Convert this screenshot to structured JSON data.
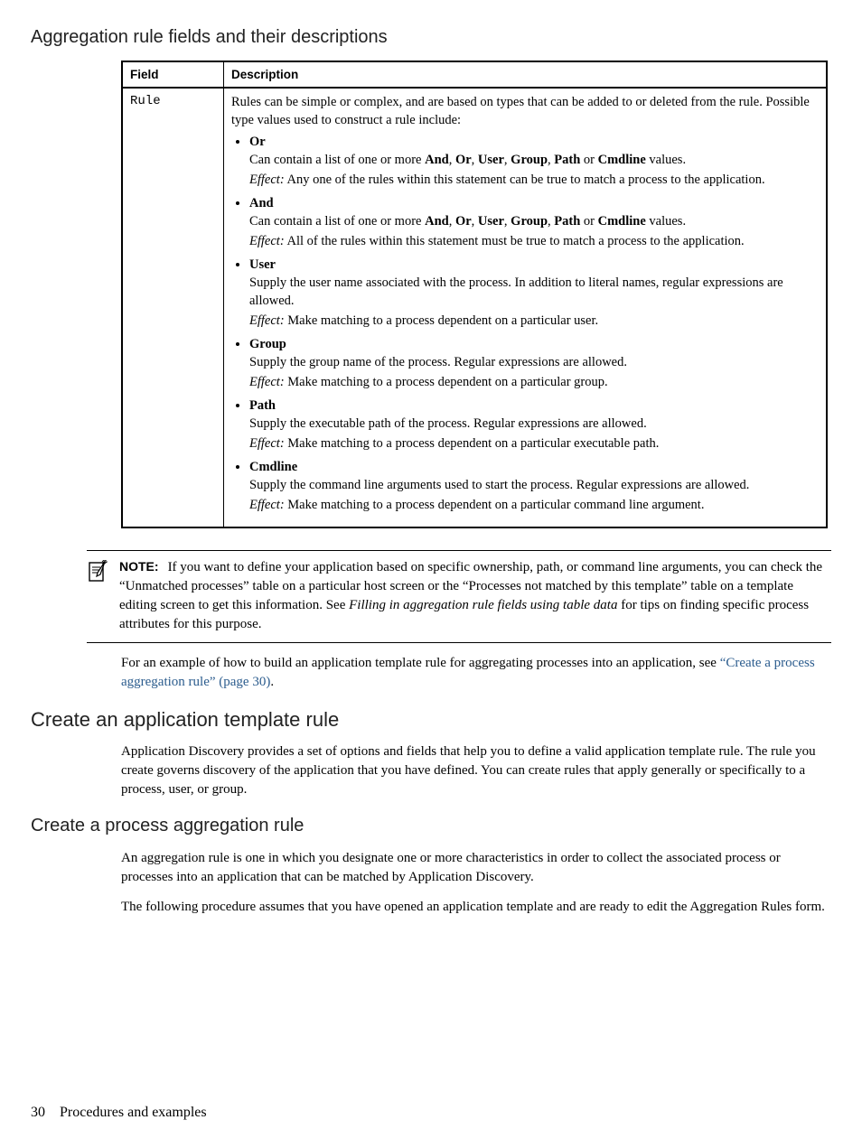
{
  "headings": {
    "h3_aggregation": "Aggregation rule fields and their descriptions",
    "h2_create_template": "Create an application template rule",
    "h3_create_process": "Create a process aggregation rule"
  },
  "table": {
    "headers": {
      "field": "Field",
      "description": "Description"
    },
    "field_value": "Rule",
    "intro": "Rules can be simple or complex, and are based on types that can be added to or deleted from the rule. Possible type values used to construct a rule include:",
    "effect_label": "Effect:",
    "items": [
      {
        "name": "Or",
        "body_pre": "Can contain a list of one or more ",
        "body_list": [
          "And",
          "Or",
          "User",
          "Group",
          "Path",
          "Cmdline"
        ],
        "body_post": " values.",
        "effect": " Any one of the rules within this statement can be true to match a process to the application."
      },
      {
        "name": "And",
        "body_pre": "Can contain a list of one or more ",
        "body_list": [
          "And",
          "Or",
          "User",
          "Group",
          "Path",
          "Cmdline"
        ],
        "body_post": " values.",
        "effect": " All of the rules within this statement must be true to match a process to the application."
      },
      {
        "name": "User",
        "body_plain": "Supply the user name associated with the process. In addition to literal names, regular expressions are allowed.",
        "effect": " Make matching to a process dependent on a particular user."
      },
      {
        "name": "Group",
        "body_plain": "Supply the group name of the process. Regular expressions are allowed.",
        "effect": " Make matching to a process dependent on a particular group."
      },
      {
        "name": "Path",
        "body_plain": "Supply the executable path of the process. Regular expressions are allowed.",
        "effect": " Make matching to a process dependent on a particular executable path."
      },
      {
        "name": "Cmdline",
        "body_plain": "Supply the command line arguments used to start the process. Regular expressions are allowed.",
        "effect": " Make matching to a process dependent on a particular command line argument."
      }
    ]
  },
  "note": {
    "label": "NOTE:",
    "text_pre": "If you want to define your application based on specific ownership, path, or command line arguments, you can check the “Unmatched processes” table on a particular host screen or the “Processes not matched by this template” table on a template editing screen to get this information.  See ",
    "text_italic": "Filling in aggregation rule fields using table data",
    "text_post": " for tips on finding specific process attributes for this purpose."
  },
  "paragraphs": {
    "example_pre": "For an example of how to build an application template rule for aggregating processes into an application, see ",
    "example_link": "“Create a process aggregation rule” (page 30)",
    "example_post": ".",
    "template_rule": "Application Discovery provides a set of options and fields that help you to define a valid application template rule. The rule you create governs discovery of the application that you have defined. You can create rules that apply generally or specifically to a process, user, or group.",
    "agg_rule_1": "An aggregation rule is one in which you designate one or more characteristics in order to collect the associated process or processes into an application that can be matched by Application Discovery.",
    "agg_rule_2": "The following procedure assumes that you have opened an application template and are ready to edit the Aggregation Rules form."
  },
  "footer": {
    "page": "30",
    "section": "Procedures and examples"
  }
}
